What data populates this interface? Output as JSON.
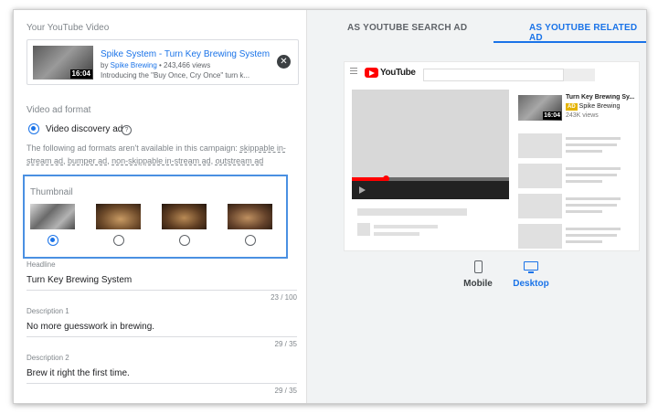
{
  "video": {
    "section_label": "Your YouTube Video",
    "title": "Spike System - Turn Key Brewing System",
    "by_prefix": "by ",
    "channel": "Spike Brewing",
    "views": " • 243,466 views",
    "description": "Introducing the \"Buy Once, Cry Once\" turn k...",
    "duration": "16:04",
    "remove_icon": "close-circle-icon"
  },
  "format": {
    "section_label": "Video ad format",
    "option_label": "Video discovery ad",
    "help_icon": "help-circle-icon",
    "na_prefix": "The following ad formats aren't available in this campaign: ",
    "na_formats": [
      "skippable in-stream ad",
      "bumper ad",
      "non-skippable in-stream ad",
      "outstream ad"
    ]
  },
  "thumbnail": {
    "section_label": "Thumbnail",
    "options": [
      {
        "id": "thumb-1",
        "selected": true
      },
      {
        "id": "thumb-2",
        "selected": false
      },
      {
        "id": "thumb-3",
        "selected": false
      },
      {
        "id": "thumb-4",
        "selected": false
      }
    ]
  },
  "fields": {
    "headline": {
      "label": "Headline",
      "value": "Turn Key Brewing System",
      "counter": "23 / 100"
    },
    "description1": {
      "label": "Description 1",
      "value": "No more guesswork in brewing.",
      "counter": "29 / 35"
    },
    "description2": {
      "label": "Description 2",
      "value": "Brew it right the first time.",
      "counter": "29 / 35"
    }
  },
  "tabs": {
    "search": "AS YOUTUBE SEARCH AD",
    "related": "AS YOUTUBE RELATED AD",
    "active": "related"
  },
  "preview": {
    "brand": "YouTube",
    "ad_title": "Turn Key Brewing Sy...",
    "ad_badge": "AD",
    "ad_channel": "Spike Brewing",
    "ad_views": "243K views",
    "ad_duration": "16:04"
  },
  "devices": {
    "mobile": "Mobile",
    "desktop": "Desktop",
    "active": "desktop"
  },
  "colors": {
    "accent": "#1a73e8",
    "highlight_border": "#4a90e2",
    "youtube_red": "#ff0000",
    "ad_badge": "#e5b400"
  }
}
